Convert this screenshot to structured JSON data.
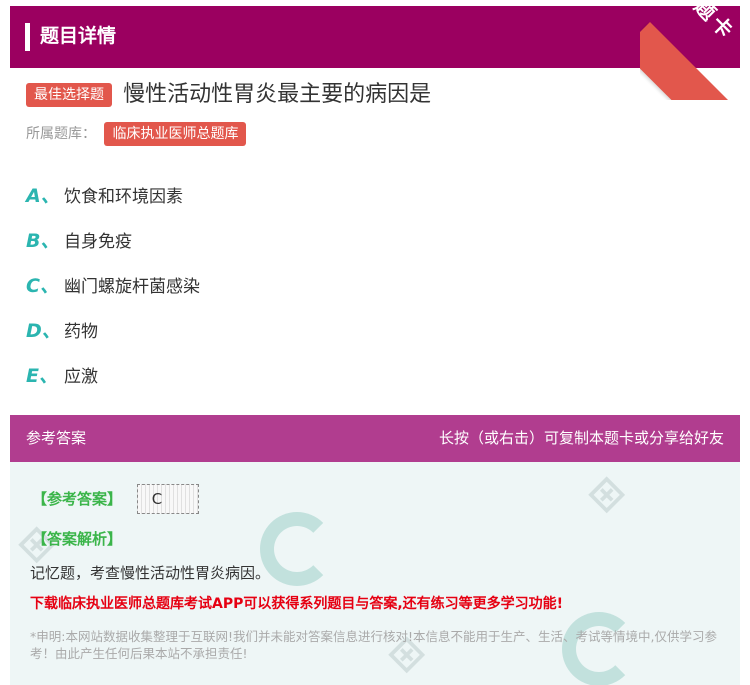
{
  "header": {
    "title": "题目详情"
  },
  "corner": {
    "label": "题卡"
  },
  "question": {
    "type_badge": "最佳选择题",
    "text": "慢性活动性胃炎最主要的病因是",
    "source_label": "所属题库：",
    "source_value": "临床执业医师总题库"
  },
  "options": [
    {
      "letter": "A、",
      "text": "饮食和环境因素"
    },
    {
      "letter": "B、",
      "text": "自身免疫"
    },
    {
      "letter": "C、",
      "text": "幽门螺旋杆菌感染"
    },
    {
      "letter": "D、",
      "text": "药物"
    },
    {
      "letter": "E、",
      "text": "应激"
    }
  ],
  "answer_section": {
    "title": "参考答案",
    "hint": "长按（或右击）可复制本题卡或分享给好友",
    "answer_label": "【参考答案】",
    "answer_value": "C",
    "analysis_label": "【答案解析】",
    "analysis_text": "记忆题，考查慢性活动性胃炎病因。",
    "promo_text": "下载临床执业医师总题库考试APP可以获得系列题目与答案,还有练习等更多学习功能!",
    "disclaimer": "*申明:本网站数据收集整理于互联网!我们并未能对答案信息进行核对!本信息不能用于生产、生活、考试等情境中,仅供学习参考！由此产生任何后果本站不承担责任!"
  },
  "colors": {
    "header_bg": "#9b0060",
    "badge_bg": "#e2574c",
    "option_letter": "#2bb5b0",
    "answer_header_bg": "#b13d8f",
    "answer_panel_bg": "#eef6f6",
    "label_green": "#3bb54a",
    "promo_red": "#e60012"
  }
}
